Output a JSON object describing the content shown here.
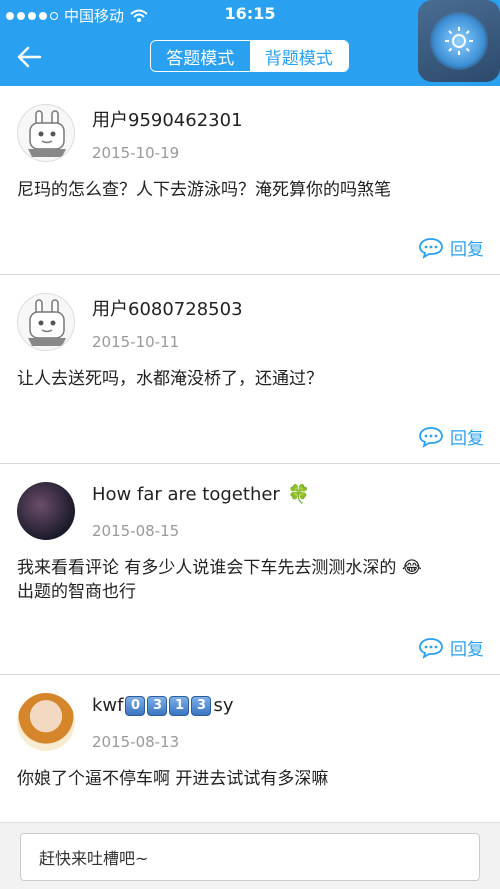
{
  "status": {
    "carrier": "中国移动",
    "time": "16:15"
  },
  "nav": {
    "tabs": [
      "答题模式",
      "背题模式"
    ],
    "active_tab": 1
  },
  "comments": [
    {
      "username": "用户9590462301",
      "date": "2015-10-19",
      "content": "尼玛的怎么查？人下去游泳吗？淹死算你的吗煞笔",
      "reply_label": "回复",
      "avatar": "robot"
    },
    {
      "username": "用户6080728503",
      "date": "2015-10-11",
      "content": "让人去送死吗，水都淹没桥了，还通过？",
      "reply_label": "回复",
      "avatar": "robot"
    },
    {
      "username": "How far are together",
      "username_emoji": "🍀",
      "date": "2015-08-15",
      "content": "我来看看评论  有多少人说谁会下车先去测测水深的",
      "content_emoji": "😂",
      "content_line2": "出题的智商也行",
      "reply_label": "回复",
      "avatar": "dark"
    },
    {
      "username_prefix": "kwf",
      "username_keys": [
        "0",
        "3",
        "1",
        "3"
      ],
      "username_suffix": "sy",
      "date": "2015-08-13",
      "content": "你娘了个逼不停车啊 开进去试试有多深嘛",
      "avatar": "girl"
    }
  ],
  "input": {
    "placeholder": "赶快来吐槽吧~"
  },
  "colors": {
    "brand": "#2aa0f0"
  }
}
